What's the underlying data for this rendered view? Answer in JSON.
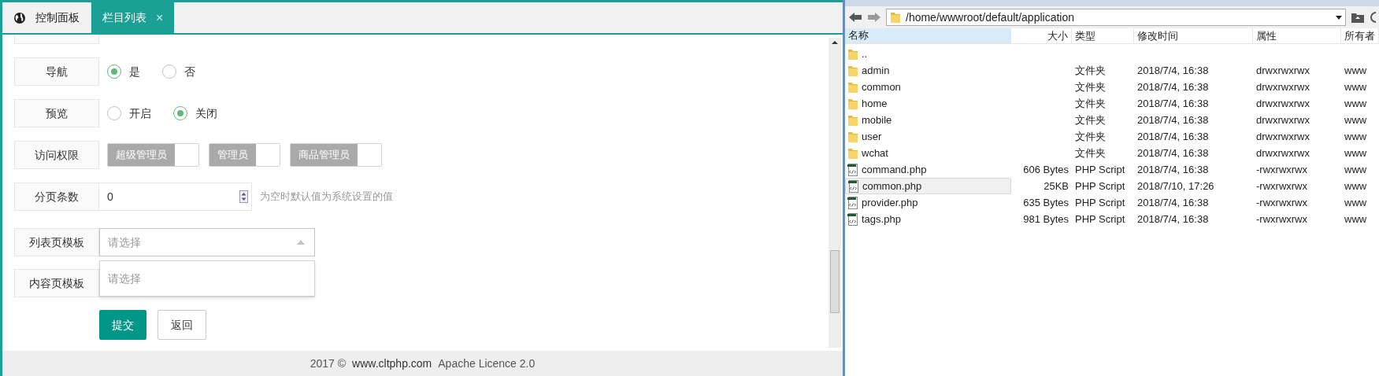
{
  "tabs": [
    {
      "label": "控制面板",
      "selected": false,
      "kind": "home"
    },
    {
      "label": "栏目列表",
      "selected": true,
      "kind": "closable",
      "close": "×"
    }
  ],
  "form": {
    "rows": [
      {
        "kind": "radio",
        "label": "导航",
        "options": [
          {
            "label": "是",
            "selected": true
          },
          {
            "label": "否",
            "selected": false
          }
        ]
      },
      {
        "kind": "radio",
        "label": "预览",
        "options": [
          {
            "label": "开启",
            "selected": false
          },
          {
            "label": "关闭",
            "selected": true
          }
        ]
      },
      {
        "kind": "checkbox",
        "label": "访问权限",
        "options": [
          {
            "label": "超级管理员",
            "checked": false
          },
          {
            "label": "管理员",
            "checked": false
          },
          {
            "label": "商品管理员",
            "checked": false
          }
        ]
      },
      {
        "kind": "number",
        "label": "分页条数",
        "value": "0",
        "hint": "为空时默认值为系统设置的值"
      },
      {
        "kind": "select",
        "label": "列表页模板",
        "placeholder": "请选择",
        "expanded": true,
        "options": [
          "请选择"
        ]
      },
      {
        "kind": "select",
        "label": "内容页模板",
        "expanded": false,
        "options": []
      }
    ],
    "buttons": [
      {
        "label": "提交",
        "kind": "primary"
      },
      {
        "label": "返回",
        "kind": "plain"
      }
    ]
  },
  "footer": {
    "year": "2017 ©",
    "site": "www.cltphp.com",
    "licence": "Apache Licence 2.0"
  },
  "file_manager": {
    "path": "/home/wwwroot/default/application",
    "columns": [
      "名称",
      "大小",
      "类型",
      "修改时间",
      "属性",
      "所有者"
    ],
    "rows": [
      {
        "kind": "folder",
        "name": "..",
        "size": "",
        "type": "",
        "modified": "",
        "attributes": "",
        "owner": "",
        "selected": false
      },
      {
        "kind": "folder",
        "name": "admin",
        "size": "",
        "type": "文件夹",
        "modified": "2018/7/4, 16:38",
        "attributes": "drwxrwxrwx",
        "owner": "www",
        "selected": false
      },
      {
        "kind": "folder",
        "name": "common",
        "size": "",
        "type": "文件夹",
        "modified": "2018/7/4, 16:38",
        "attributes": "drwxrwxrwx",
        "owner": "www",
        "selected": false
      },
      {
        "kind": "folder",
        "name": "home",
        "size": "",
        "type": "文件夹",
        "modified": "2018/7/4, 16:38",
        "attributes": "drwxrwxrwx",
        "owner": "www",
        "selected": false
      },
      {
        "kind": "folder",
        "name": "mobile",
        "size": "",
        "type": "文件夹",
        "modified": "2018/7/4, 16:38",
        "attributes": "drwxrwxrwx",
        "owner": "www",
        "selected": false
      },
      {
        "kind": "folder",
        "name": "user",
        "size": "",
        "type": "文件夹",
        "modified": "2018/7/4, 16:38",
        "attributes": "drwxrwxrwx",
        "owner": "www",
        "selected": false
      },
      {
        "kind": "folder",
        "name": "wchat",
        "size": "",
        "type": "文件夹",
        "modified": "2018/7/4, 16:38",
        "attributes": "drwxrwxrwx",
        "owner": "www",
        "selected": false
      },
      {
        "kind": "php",
        "name": "command.php",
        "size": "606 Bytes",
        "type": "PHP Script",
        "modified": "2018/7/4, 16:38",
        "attributes": "-rwxrwxrwx",
        "owner": "www",
        "selected": false
      },
      {
        "kind": "php",
        "name": "common.php",
        "size": "25KB",
        "type": "PHP Script",
        "modified": "2018/7/10, 17:26",
        "attributes": "-rwxrwxrwx",
        "owner": "www",
        "selected": true
      },
      {
        "kind": "php",
        "name": "provider.php",
        "size": "635 Bytes",
        "type": "PHP Script",
        "modified": "2018/7/4, 16:38",
        "attributes": "-rwxrwxrwx",
        "owner": "www",
        "selected": false
      },
      {
        "kind": "php",
        "name": "tags.php",
        "size": "981 Bytes",
        "type": "PHP Script",
        "modified": "2018/7/4, 16:38",
        "attributes": "-rwxrwxrwx",
        "owner": "www",
        "selected": false
      }
    ]
  }
}
